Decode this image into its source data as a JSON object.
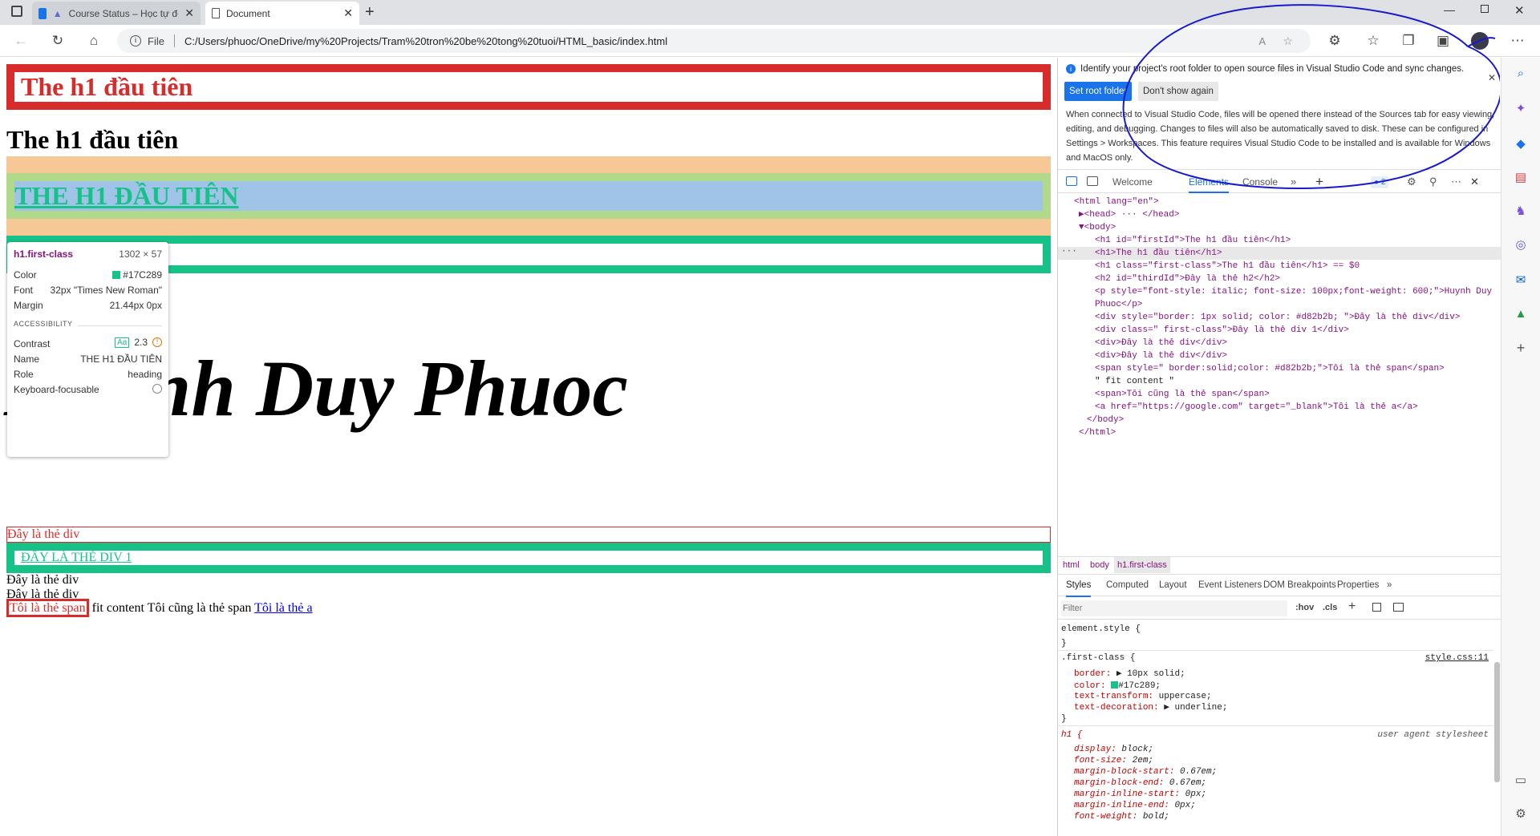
{
  "browser": {
    "tabs": [
      {
        "title": "Course Status – Học tự động hóa",
        "active": false
      },
      {
        "title": "Document",
        "active": true
      }
    ],
    "url_scheme": "File",
    "url": "C:/Users/phuoc/OneDrive/my%20Projects/Tram%20tron%20be%20tong%20tuoi/HTML_basic/index.html"
  },
  "page": {
    "h1_first": "The h1 đầu tiên",
    "h1_plain": "The h1 đầu tiên",
    "h1_class": "THE H1 ĐẦU TIÊN",
    "p_name": "Huynh Duy Phuoc",
    "div1": "Đây là thẻ div",
    "div_class": "ĐÂY LÀ THẺ DIV 1",
    "div2": "Đây là thẻ div",
    "div3": "Đây là thẻ div",
    "span1": "Tôi là thẻ span",
    "fit_text": "fit content",
    "span2": "Tôi cũng là thẻ span",
    "link": "Tôi là thẻ a"
  },
  "tooltip": {
    "selector": "h1.first-class",
    "size": "1302 × 57",
    "color_label": "Color",
    "color_value": "#17C289",
    "font_label": "Font",
    "font_value": "32px \"Times New Roman\"",
    "margin_label": "Margin",
    "margin_value": "21.44px 0px",
    "accessibility_heading": "ACCESSIBILITY",
    "contrast_label": "Contrast",
    "contrast_value": "2.3",
    "name_label": "Name",
    "name_value": "THE H1 ĐẦU TIÊN",
    "role_label": "Role",
    "role_value": "heading",
    "keyboard_label": "Keyboard-focusable"
  },
  "devtools": {
    "banner_text": "Identify your project's root folder to open source files in Visual Studio Code and sync changes.",
    "set_root_btn": "Set root folder",
    "dont_show_btn": "Don't show again",
    "banner_desc": "When connected to Visual Studio Code, files will be opened there instead of the Sources tab for easy viewing, editing, and debugging. Changes to files will also be automatically saved to disk. These can be configured in Settings > Workspaces. This feature requires Visual Studio Code to be installed and is available for Windows and MacOS only.",
    "tabs": [
      "Welcome",
      "Elements",
      "Console"
    ],
    "issues_count": "2",
    "breadcrumb": [
      "html",
      "body",
      "h1.first-class"
    ],
    "style_tabs": [
      "Styles",
      "Computed",
      "Layout",
      "Event Listeners",
      "DOM Breakpoints",
      "Properties"
    ],
    "filter_placeholder": "Filter",
    "hov": ":hov",
    "cls": ".cls",
    "element_style": "element.style {",
    "close_brace": "}",
    "rule_selector": ".first-class {",
    "rule_source": "style.css:11",
    "rule_props": [
      {
        "name": "border:",
        "value": "10px solid;"
      },
      {
        "name": "color:",
        "value": "#17c289;"
      },
      {
        "name": "text-transform:",
        "value": "uppercase;"
      },
      {
        "name": "text-decoration:",
        "value": "underline;"
      }
    ],
    "ua_selector": "h1 {",
    "ua_source": "user agent stylesheet",
    "ua_props": [
      {
        "name": "display:",
        "value": "block;"
      },
      {
        "name": "font-size:",
        "value": "2em;"
      },
      {
        "name": "margin-block-start:",
        "value": "0.67em;"
      },
      {
        "name": "margin-block-end:",
        "value": "0.67em;"
      },
      {
        "name": "margin-inline-start:",
        "value": "0px;"
      },
      {
        "name": "margin-inline-end:",
        "value": "0px;"
      },
      {
        "name": "font-weight:",
        "value": "bold;"
      }
    ],
    "dom_lines": [
      "<html lang=\"en\">",
      "▶<head> ··· </head>",
      "▼<body>",
      "<h1 id=\"firstId\">The h1 đầu tiên</h1>",
      "<h1>The h1 đầu tiên</h1>",
      "<h1 class=\"first-class\">The h1 đầu tiên</h1> == $0",
      "<h2 id=\"thirdId\">Đây là thẻ h2</h2>",
      "<p style=\"font-style: italic; font-size: 100px;font-weight: 600;\">Huynh Duy",
      "Phuoc</p>",
      "<div style=\"border: 1px solid; color: #d82b2b; \">Đây là thẻ div</div>",
      "<div class=\" first-class\">Đây là thẻ div 1</div>",
      "<div>Đây là thẻ div</div>",
      "<div>Đây là thẻ div</div>",
      "<span style=\" border:solid;color: #d82b2b;\">Tôi là thẻ span</span>",
      "\" fit content \"",
      "<span>Tôi cũng là thẻ span</span>",
      "<a href=\"https://google.com\" target=\"_blank\">Tôi là thẻ a</a>",
      "</body>",
      "</html>"
    ]
  },
  "colors": {
    "red": "#d82b2b",
    "green": "#17c289",
    "margin_orange": "#f6c895",
    "padding_green": "#b0d98b",
    "content_blue": "#9fc4e7",
    "annotation_blue": "#1a1acc"
  }
}
